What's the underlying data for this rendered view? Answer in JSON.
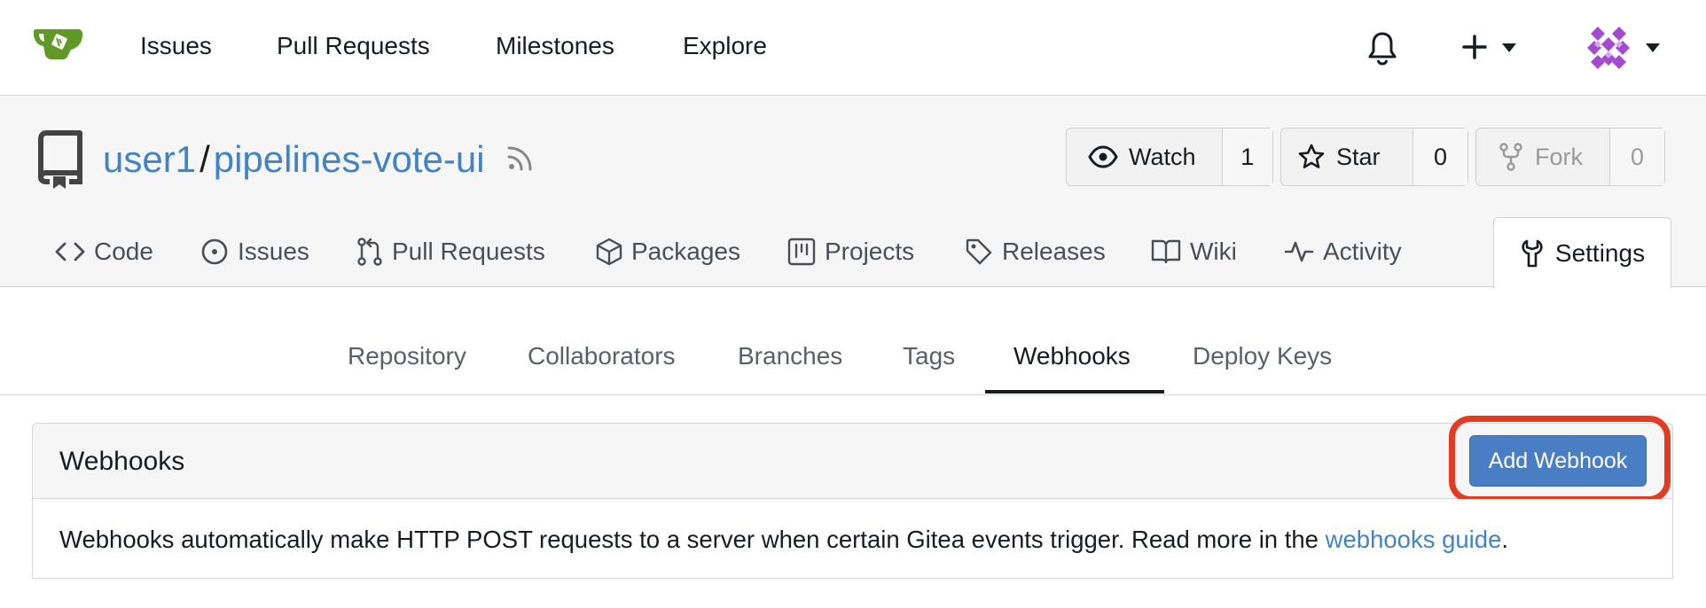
{
  "navbar": {
    "logo_icon": "gitea-logo-icon",
    "links": [
      "Issues",
      "Pull Requests",
      "Milestones",
      "Explore"
    ],
    "icons": [
      "bell-icon",
      "plus-icon",
      "avatar"
    ]
  },
  "repo": {
    "owner": "user1",
    "separator": "/",
    "name": "pipelines-vote-ui",
    "watch_label": "Watch",
    "watch_count": "1",
    "star_label": "Star",
    "star_count": "0",
    "fork_label": "Fork",
    "fork_count": "0",
    "tabs": [
      "Code",
      "Issues",
      "Pull Requests",
      "Packages",
      "Projects",
      "Releases",
      "Wiki",
      "Activity"
    ],
    "settings_tab": "Settings"
  },
  "settings_nav": {
    "items": [
      "Repository",
      "Collaborators",
      "Branches",
      "Tags",
      "Webhooks",
      "Deploy Keys"
    ],
    "active": "Webhooks"
  },
  "webhooks": {
    "title": "Webhooks",
    "add_button": "Add Webhook",
    "description": "Webhooks automatically make HTTP POST requests to a server when certain Gitea events trigger. Read more in the",
    "guide_link": "webhooks guide",
    "period": "."
  },
  "colors": {
    "link": "#4183c4",
    "primary_button": "#4a7ec4",
    "highlight": "#e23b22"
  }
}
